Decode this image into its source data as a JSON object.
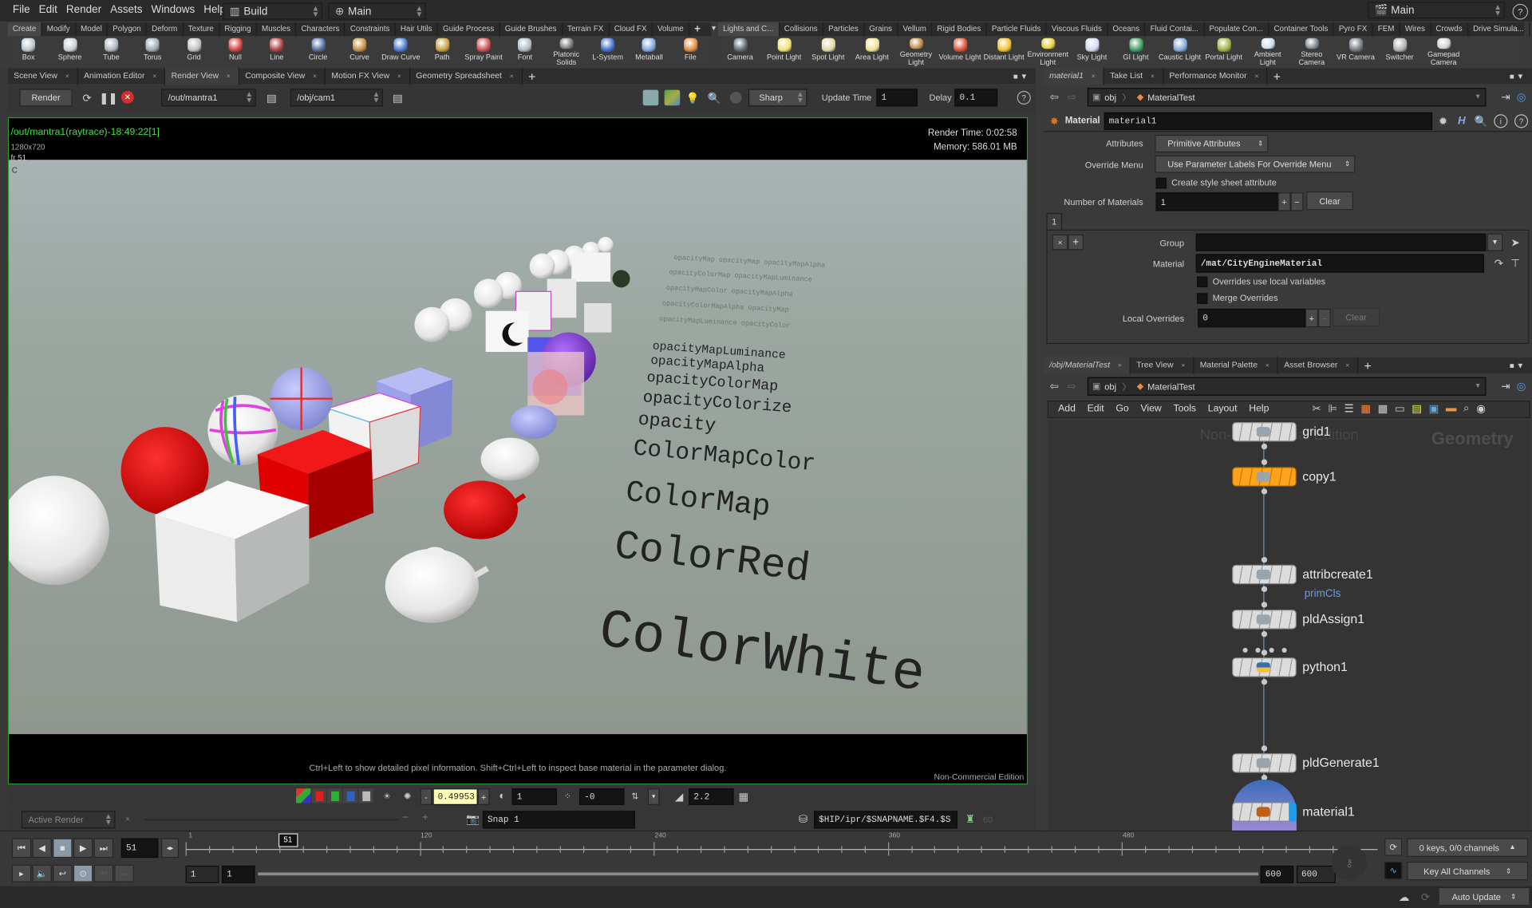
{
  "menu": {
    "items": [
      "File",
      "Edit",
      "Render",
      "Assets",
      "Windows",
      "Help"
    ],
    "desktop": "Build",
    "viewport_layout": "Main",
    "right_desktop": "Main",
    "help": "?"
  },
  "shelf_left": {
    "tabs": [
      "Create",
      "Modify",
      "Model",
      "Polygon",
      "Deform",
      "Texture",
      "Rigging",
      "Muscles",
      "Characters",
      "Constraints",
      "Hair Utils",
      "Guide Process",
      "Guide Brushes",
      "Terrain FX",
      "Cloud FX",
      "Volume"
    ],
    "active_tab": "Create",
    "tools": [
      {
        "label": "Box",
        "icon": "box-icon",
        "color": "#b9c4cc"
      },
      {
        "label": "Sphere",
        "icon": "sphere-icon",
        "color": "#c8ccd2"
      },
      {
        "label": "Tube",
        "icon": "tube-icon",
        "color": "#aab4bc"
      },
      {
        "label": "Torus",
        "icon": "torus-icon",
        "color": "#9fa7ae"
      },
      {
        "label": "Grid",
        "icon": "grid-icon",
        "color": "#c0c0c0"
      },
      {
        "label": "Null",
        "icon": "null-icon",
        "color": "#d84040"
      },
      {
        "label": "Line",
        "icon": "line-icon",
        "color": "#b04040"
      },
      {
        "label": "Circle",
        "icon": "circle-icon",
        "color": "#5070a0"
      },
      {
        "label": "Curve",
        "icon": "curve-icon",
        "color": "#c09040"
      },
      {
        "label": "Draw Curve",
        "icon": "draw-curve-icon",
        "color": "#4a7ad0"
      },
      {
        "label": "Path",
        "icon": "path-icon",
        "color": "#c8a040"
      },
      {
        "label": "Spray Paint",
        "icon": "spray-paint-icon",
        "color": "#d05050"
      },
      {
        "label": "Font",
        "icon": "font-icon",
        "color": "#b0b8c0"
      },
      {
        "label": "Platonic Solids",
        "icon": "platonic-solids-icon",
        "color": "#808080"
      },
      {
        "label": "L-System",
        "icon": "l-system-icon",
        "color": "#4070d0"
      },
      {
        "label": "Metaball",
        "icon": "metaball-icon",
        "color": "#80a8e0"
      },
      {
        "label": "File",
        "icon": "file-icon",
        "color": "#e08a40"
      }
    ]
  },
  "shelf_right": {
    "tabs": [
      "Lights and C...",
      "Collisions",
      "Particles",
      "Grains",
      "Vellum",
      "Rigid Bodies",
      "Particle Fluids",
      "Viscous Fluids",
      "Oceans",
      "Fluid Contai...",
      "Populate Con...",
      "Container Tools",
      "Pyro FX",
      "FEM",
      "Wires",
      "Crowds",
      "Drive Simula..."
    ],
    "active_tab": "Lights and C...",
    "tools": [
      {
        "label": "Camera",
        "icon": "camera-icon",
        "color": "#606870"
      },
      {
        "label": "Point Light",
        "icon": "point-light-icon",
        "color": "#f0e070"
      },
      {
        "label": "Spot Light",
        "icon": "spot-light-icon",
        "color": "#e0d8a0"
      },
      {
        "label": "Area Light",
        "icon": "area-light-icon",
        "color": "#f0e090"
      },
      {
        "label": "Geometry Light",
        "icon": "geometry-light-icon",
        "color": "#c09050"
      },
      {
        "label": "Volume Light",
        "icon": "volume-light-icon",
        "color": "#e05030"
      },
      {
        "label": "Distant Light",
        "icon": "distant-light-icon",
        "color": "#f0c030"
      },
      {
        "label": "Environment Light",
        "icon": "environment-light-icon",
        "color": "#e8d040"
      },
      {
        "label": "Sky Light",
        "icon": "sky-light-icon",
        "color": "#d0d8f0"
      },
      {
        "label": "GI Light",
        "icon": "gi-light-icon",
        "color": "#40a060"
      },
      {
        "label": "Caustic Light",
        "icon": "caustic-light-icon",
        "color": "#80a8d8"
      },
      {
        "label": "Portal Light",
        "icon": "portal-light-icon",
        "color": "#a0b040"
      },
      {
        "label": "Ambient Light",
        "icon": "ambient-light-icon",
        "color": "#c8e0f0"
      },
      {
        "label": "Stereo Camera",
        "icon": "stereo-camera-icon",
        "color": "#808890"
      },
      {
        "label": "VR Camera",
        "icon": "vr-camera-icon",
        "color": "#707880"
      },
      {
        "label": "Switcher",
        "icon": "switcher-icon",
        "color": "#b0b0b0"
      },
      {
        "label": "Gamepad Camera",
        "icon": "gamepad-camera-icon",
        "color": "#d0d0d0"
      }
    ]
  },
  "left_pane": {
    "tabs": [
      "Scene View",
      "Animation Editor",
      "Render View",
      "Composite View",
      "Motion FX View",
      "Geometry Spreadsheet"
    ],
    "active_tab": "Render View",
    "toolbar": {
      "render_label": "Render",
      "rop": "/out/mantra1",
      "camera": "/obj/cam1",
      "preview_mode": "Sharp",
      "update_time_label": "Update Time",
      "update_time": "1",
      "delay_label": "Delay",
      "delay": "0.1"
    },
    "render_info": {
      "title": "/out/mantra1(raytrace)-18:49:22[1]",
      "resolution": "1280x720",
      "frame": "fr 51",
      "channel": "C",
      "render_time": "Render Time: 0:02:58",
      "memory": "Memory:  586.01 MB"
    },
    "scene_labels": [
      "ColorWhite",
      "ColorRed",
      "ColorMap",
      "ColorMapColor",
      "opacity",
      "opacityColorize",
      "opacityColorMap",
      "opacityMapAlpha",
      "opacityMapLuminance"
    ],
    "hint": "Ctrl+Left to show detailed pixel information. Shift+Ctrl+Left to inspect base material in the parameter dialog.",
    "watermark": "Non-Commercial Edition",
    "controls": {
      "exposure": "0.49953",
      "gamma_lut": "1",
      "offset": "-0",
      "gamma": "2.2",
      "active_render": "Active Render",
      "snap": "Snap 1",
      "snapshot_path": "$HIP/ipr/$SNAPNAME.$F4.$S",
      "snap_count": "60"
    }
  },
  "timeline": {
    "current_frame": "51",
    "marker": "51",
    "tick_labels": [
      "1",
      "120",
      "240",
      "360",
      "480"
    ],
    "range_start": "1",
    "range_start2": "1",
    "range_end": "600",
    "range_end2": "600",
    "keys_status": "0 keys, 0/0 channels",
    "key_mode": "Key All Channels",
    "update_mode": "Auto Update",
    "playhead_fraction": 0.085
  },
  "param_pane": {
    "tabs": [
      "material1",
      "Take List",
      "Performance Monitor"
    ],
    "path": [
      "obj",
      "MaterialTest"
    ],
    "node_type": "Material",
    "node_name": "material1",
    "attributes_label": "Attributes",
    "attributes": "Primitive Attributes",
    "override_menu_label": "Override Menu",
    "override_menu": "Use Parameter Labels For Override Menu",
    "style_sheet_label": "Create style sheet attribute",
    "style_sheet": false,
    "num_materials_label": "Number of Materials",
    "num_materials": "1",
    "clear": "Clear",
    "multi_tab": "1",
    "group_label": "Group",
    "group": "",
    "material_label": "Material",
    "material": "/mat/CityEngineMaterial",
    "local_vars_label": "Overrides use local variables",
    "local_vars": false,
    "merge_label": "Merge Overrides",
    "merge": false,
    "local_overrides_label": "Local Overrides",
    "local_overrides": "0"
  },
  "network_pane": {
    "tabs": [
      "/obj/MaterialTest",
      "Tree View",
      "Material Palette",
      "Asset Browser"
    ],
    "path": [
      "obj",
      "MaterialTest"
    ],
    "menu": [
      "Add",
      "Edit",
      "Go",
      "View",
      "Tools",
      "Layout",
      "Help"
    ],
    "watermark": "Non-Commercial Edition",
    "context": "Geometry",
    "nodes": [
      {
        "name": "grid1",
        "color": "#dcdcdc"
      },
      {
        "name": "copy1",
        "color": "#ffa31a"
      },
      {
        "name": "attribcreate1",
        "color": "#dcdcdc",
        "note": "primCls"
      },
      {
        "name": "pldAssign1",
        "color": "#dcdcdc"
      },
      {
        "name": "python1",
        "color": "#dcdcdc"
      },
      {
        "name": "pldGenerate1",
        "color": "#dcdcdc"
      },
      {
        "name": "material1",
        "color": "#dcdcdc",
        "display_flag": "#1e9ee8"
      }
    ]
  },
  "colors": {
    "render_border": "#2a9d2a",
    "title_green": "#44e044",
    "exposure_bg": "#ffffb8",
    "node_selected": "#ffa31a",
    "note": "#6c9be0"
  }
}
